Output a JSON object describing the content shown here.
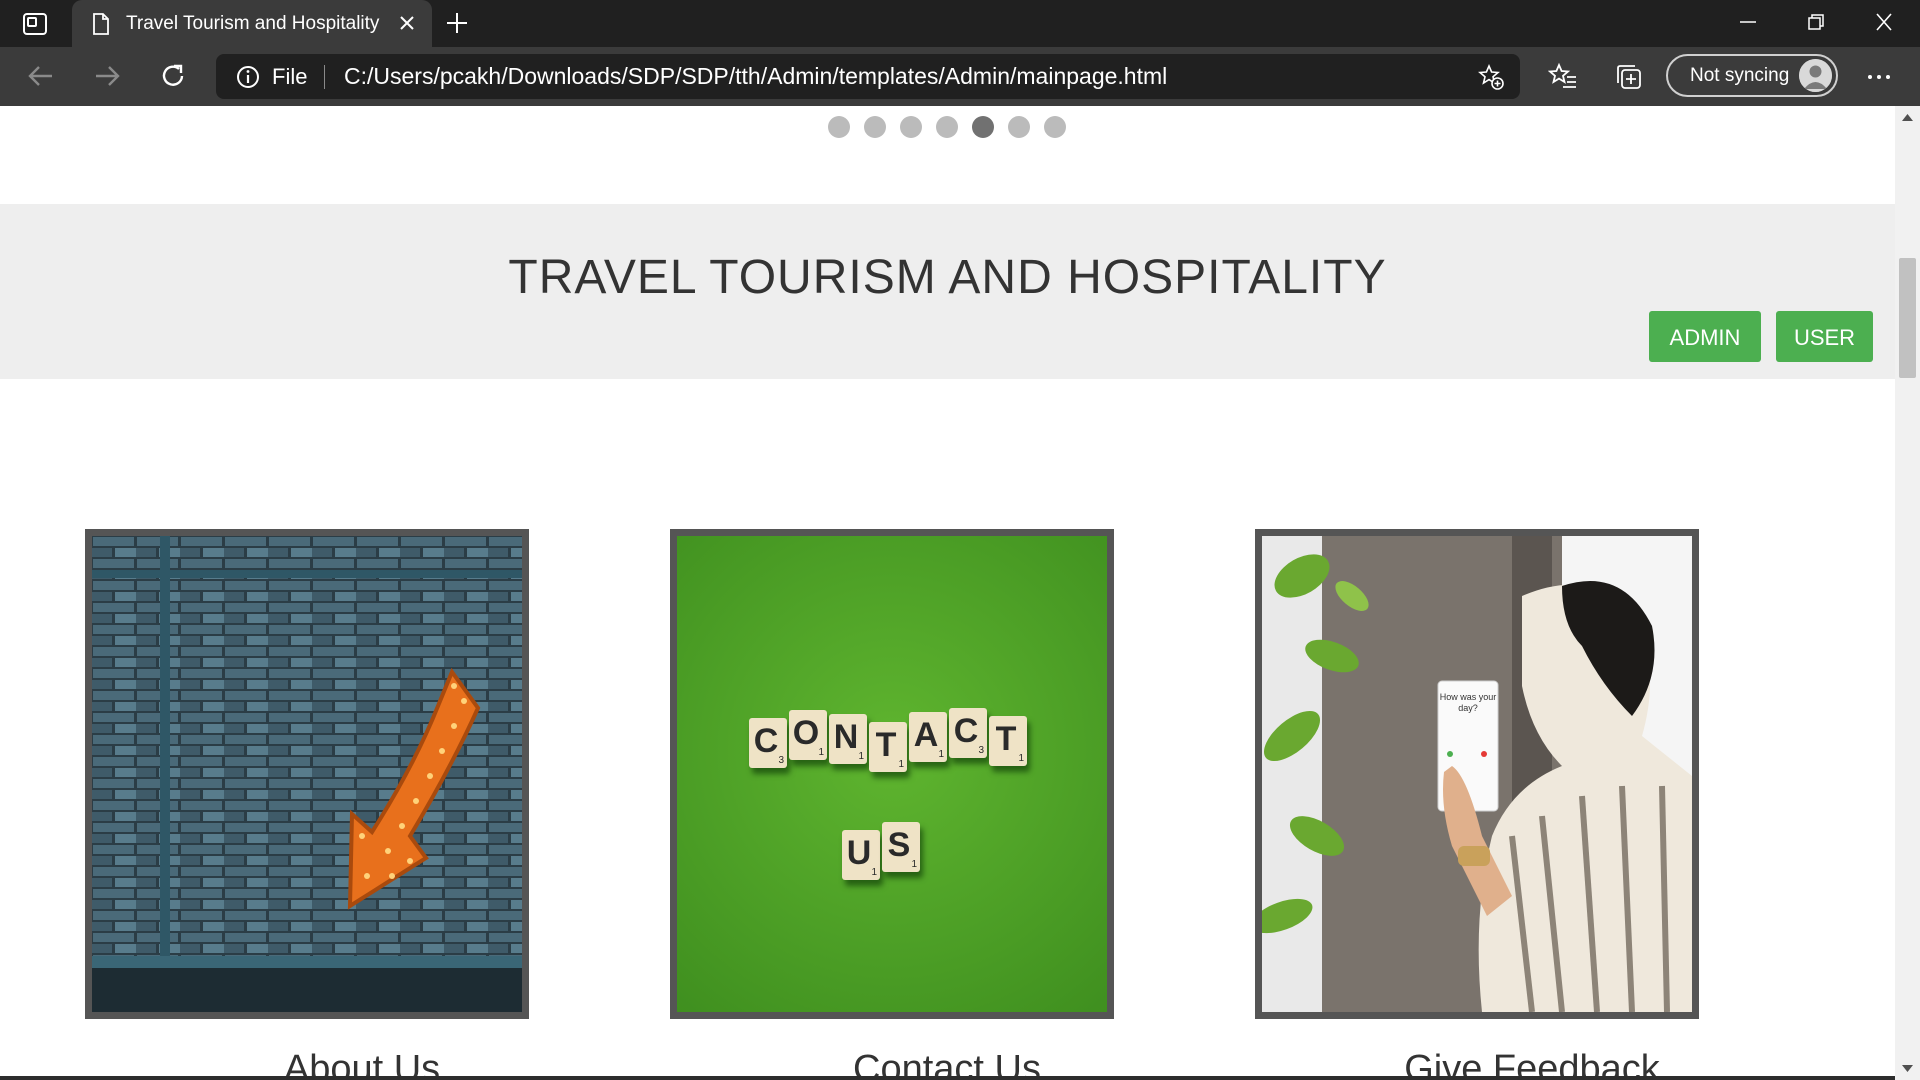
{
  "browser": {
    "tab_title": "Travel Tourism and Hospitality",
    "address": {
      "scheme_label": "File",
      "url": "C:/Users/pcakh/Downloads/SDP/SDP/tth/Admin/templates/Admin/mainpage.html"
    },
    "sync_label": "Not syncing"
  },
  "page": {
    "slideshow": {
      "dot_count": 7,
      "active_dot": 5
    },
    "header": {
      "title": "TRAVEL TOURISM AND HOSPITALITY",
      "admin_label": "ADMIN",
      "user_label": "USER",
      "button_color": "#4caf50"
    },
    "cards": [
      {
        "caption": "About Us"
      },
      {
        "caption": "Contact Us"
      },
      {
        "caption": "Give Feedback"
      }
    ],
    "contact_tiles": {
      "row1": [
        "C",
        "O",
        "N",
        "T",
        "A",
        "C",
        "T"
      ],
      "row1_points": [
        "3",
        "1",
        "1",
        "1",
        "1",
        "3",
        "1"
      ],
      "row2": [
        "U",
        "S"
      ],
      "row2_points": [
        "1",
        "1"
      ]
    },
    "feedback_tablet": {
      "question": "How was your day?"
    }
  }
}
